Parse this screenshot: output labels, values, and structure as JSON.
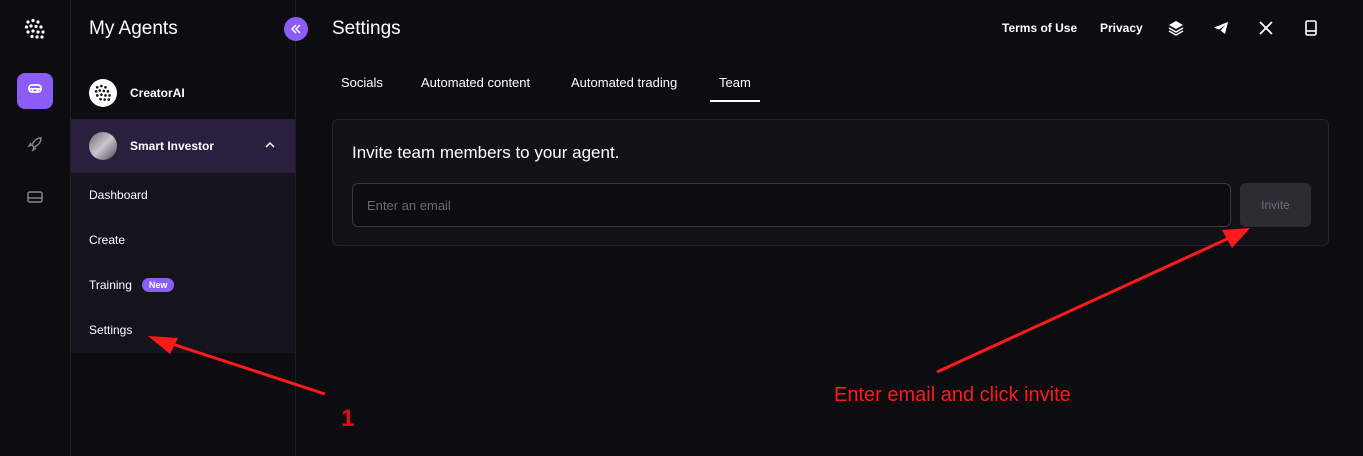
{
  "sidebar": {
    "title": "My Agents",
    "agents": [
      {
        "name": "CreatorAI"
      },
      {
        "name": "Smart Investor"
      }
    ],
    "submenu": [
      {
        "label": "Dashboard"
      },
      {
        "label": "Create"
      },
      {
        "label": "Training",
        "badge": "New"
      },
      {
        "label": "Settings"
      }
    ]
  },
  "header": {
    "title": "Settings",
    "links": {
      "terms": "Terms of Use",
      "privacy": "Privacy"
    },
    "icons": [
      "stack-icon",
      "telegram-icon",
      "x-icon",
      "book-icon"
    ]
  },
  "tabs": [
    "Socials",
    "Automated content",
    "Automated trading",
    "Team"
  ],
  "active_tab": "Team",
  "invite": {
    "title": "Invite team members to your agent.",
    "placeholder": "Enter an email",
    "value": "",
    "button": "Invite"
  },
  "annotations": {
    "step_number": "1",
    "instruction": "Enter email and click invite",
    "color": "#ff1a1a"
  },
  "colors": {
    "accent": "#8b5cf6",
    "background": "#0d0c11"
  }
}
